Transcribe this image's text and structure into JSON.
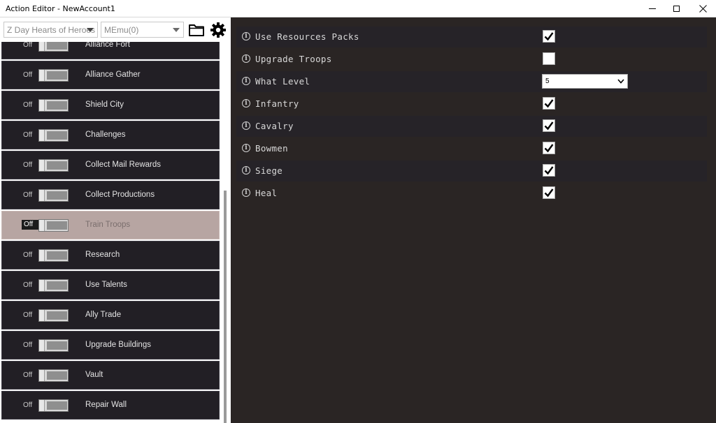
{
  "window": {
    "title": "Action Editor - NewAccount1"
  },
  "toolbar": {
    "game_select": "Z Day Hearts of Heroes",
    "emulator_select": "MEmu(0)",
    "folder_icon": "folder-icon",
    "settings_icon": "gear-icon"
  },
  "actions": [
    {
      "label": "Alliance Fort",
      "state": "Off"
    },
    {
      "label": "Alliance Gather",
      "state": "Off"
    },
    {
      "label": "Shield City",
      "state": "Off"
    },
    {
      "label": "Challenges",
      "state": "Off"
    },
    {
      "label": "Collect Mail Rewards",
      "state": "Off"
    },
    {
      "label": "Collect Productions",
      "state": "Off"
    },
    {
      "label": "Train Troops",
      "state": "Off",
      "selected": true
    },
    {
      "label": "Research",
      "state": "Off"
    },
    {
      "label": "Use Talents",
      "state": "Off"
    },
    {
      "label": "Ally Trade",
      "state": "Off"
    },
    {
      "label": "Upgrade Buildings",
      "state": "Off"
    },
    {
      "label": "Vault",
      "state": "Off"
    },
    {
      "label": "Repair Wall",
      "state": "Off"
    }
  ],
  "settings": [
    {
      "label": "Use Resources Packs",
      "type": "checkbox",
      "checked": true
    },
    {
      "label": "Upgrade Troops",
      "type": "checkbox",
      "checked": false
    },
    {
      "label": "What Level",
      "type": "select",
      "value": "5"
    },
    {
      "label": "Infantry",
      "type": "checkbox",
      "checked": true
    },
    {
      "label": "Cavalry",
      "type": "checkbox",
      "checked": true
    },
    {
      "label": "Bowmen",
      "type": "checkbox",
      "checked": true
    },
    {
      "label": "Siege",
      "type": "checkbox",
      "checked": true
    },
    {
      "label": "Heal",
      "type": "checkbox",
      "checked": true
    }
  ],
  "colors": {
    "panel_bg": "#2a2524",
    "item_bg": "#221f25",
    "selected_bg": "#b7a5a2"
  }
}
